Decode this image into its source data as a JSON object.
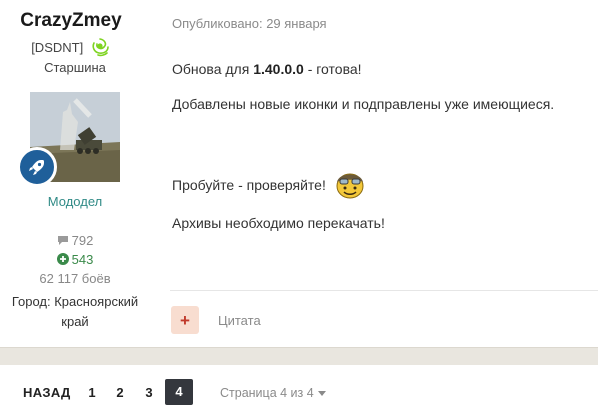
{
  "author": {
    "name": "CrazyZmey",
    "clan": "[DSDNT]",
    "rank": "Старшина",
    "group": "Мододел",
    "comments": "792",
    "reputation": "543",
    "battles": "62 117 боёв",
    "city_line1": "Город: Красноярский",
    "city_line2": "край"
  },
  "post": {
    "date": "Опубликовано: 29 января",
    "line1_prefix": "Обнова для ",
    "line1_version": "1.40.0.0",
    "line1_suffix": " - готова!",
    "line2": "Добавлены новые иконки и подправлены уже имеющиеся.",
    "line3": "Пробуйте - проверяйте!",
    "line4": "Архивы необходимо перекачать!"
  },
  "actions": {
    "plus_symbol": "+",
    "quote": "Цитата"
  },
  "pagination": {
    "back": "НАЗАД",
    "pages": [
      "1",
      "2",
      "3"
    ],
    "current": "4",
    "info": "Страница 4 из 4"
  },
  "colors": {
    "group": "#2f8a86",
    "likes": "#3a8a4a",
    "badge": "#1f5f9a",
    "plus_bg": "#f8ddd0",
    "plus_fg": "#c0392b",
    "current_page_bg": "#34373d"
  },
  "icons": {
    "clan": "razer-snake-icon",
    "badge": "rocket-icon",
    "comments": "speech-bubble-icon",
    "reputation": "plus-circle-icon",
    "smiley": "tanker-smiley-icon"
  }
}
